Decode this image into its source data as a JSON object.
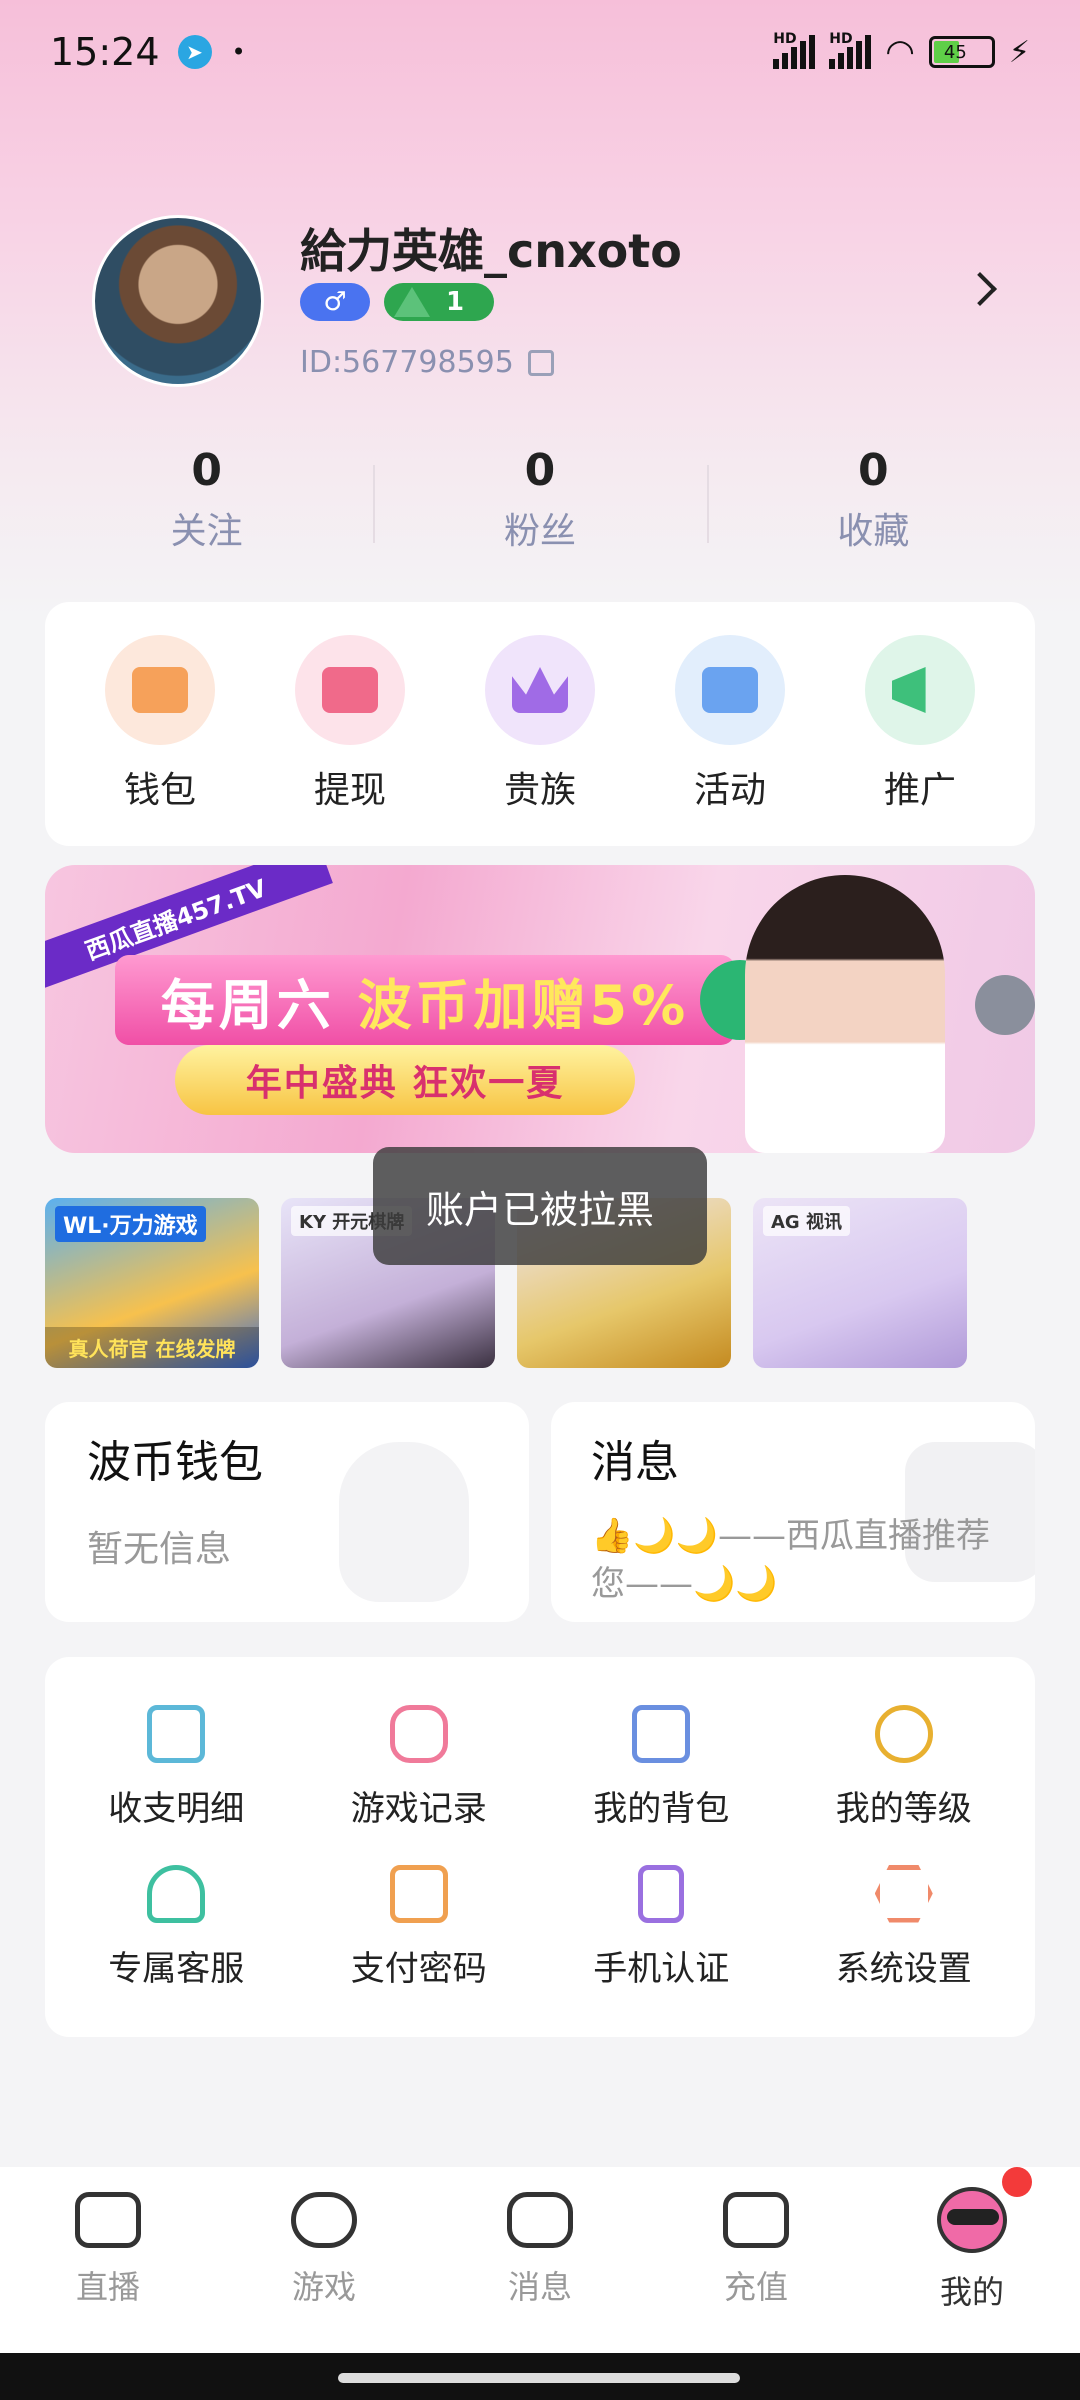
{
  "status_bar": {
    "time": "15:24",
    "telegram_icon": "telegram-icon",
    "dot": "•",
    "signal_1": "HD",
    "signal_2": "HD",
    "battery": "45"
  },
  "profile": {
    "username": "給力英雄_cnxoto",
    "gender_symbol": "♂",
    "level": "1",
    "id_text": "ID:567798595"
  },
  "stats": [
    {
      "value": "0",
      "label": "关注"
    },
    {
      "value": "0",
      "label": "粉丝"
    },
    {
      "value": "0",
      "label": "收藏"
    }
  ],
  "quick_actions": [
    {
      "label": "钱包",
      "color": "#f6a15a",
      "bg": "#fde8dc"
    },
    {
      "label": "提现",
      "color": "#f06a8a",
      "bg": "#fde3ea"
    },
    {
      "label": "贵族",
      "color": "#a06be6",
      "bg": "#f0e4fb"
    },
    {
      "label": "活动",
      "color": "#6aa3f0",
      "bg": "#e2eefc"
    },
    {
      "label": "推广",
      "color": "#3ec07b",
      "bg": "#dff5e9"
    }
  ],
  "banner": {
    "ribbon": "西瓜直播457.TV",
    "headline_part1": "每周六",
    "headline_part2": "波币加赠5%",
    "sub": "年中盛典 狂欢一夏"
  },
  "games": [
    {
      "tag": "WL·万力游戏",
      "caption": "真人荷官 在线发牌"
    },
    {
      "tag": "KY 开元棋牌",
      "caption": ""
    },
    {
      "tag": "",
      "caption": ""
    },
    {
      "tag": "AG 视讯",
      "caption": ""
    }
  ],
  "toast": "账户已被拉黑",
  "wallet": {
    "title": "波币钱包",
    "subtitle": "暂无信息"
  },
  "message": {
    "title": "消息",
    "text": "👍🌙🌙——西瓜直播推荐您——🌙🌙"
  },
  "tools": [
    {
      "label": "收支明细",
      "color": "#5cb8d8"
    },
    {
      "label": "游戏记录",
      "color": "#f07a9a"
    },
    {
      "label": "我的背包",
      "color": "#6a8fe0"
    },
    {
      "label": "我的等级",
      "color": "#e8b030"
    },
    {
      "label": "专属客服",
      "color": "#3ec0a0"
    },
    {
      "label": "支付密码",
      "color": "#f0a050"
    },
    {
      "label": "手机认证",
      "color": "#9a70e0"
    },
    {
      "label": "系统设置",
      "color": "#f08a6a"
    }
  ],
  "tabs": [
    {
      "label": "直播"
    },
    {
      "label": "游戏"
    },
    {
      "label": "消息"
    },
    {
      "label": "充值"
    },
    {
      "label": "我的"
    }
  ]
}
